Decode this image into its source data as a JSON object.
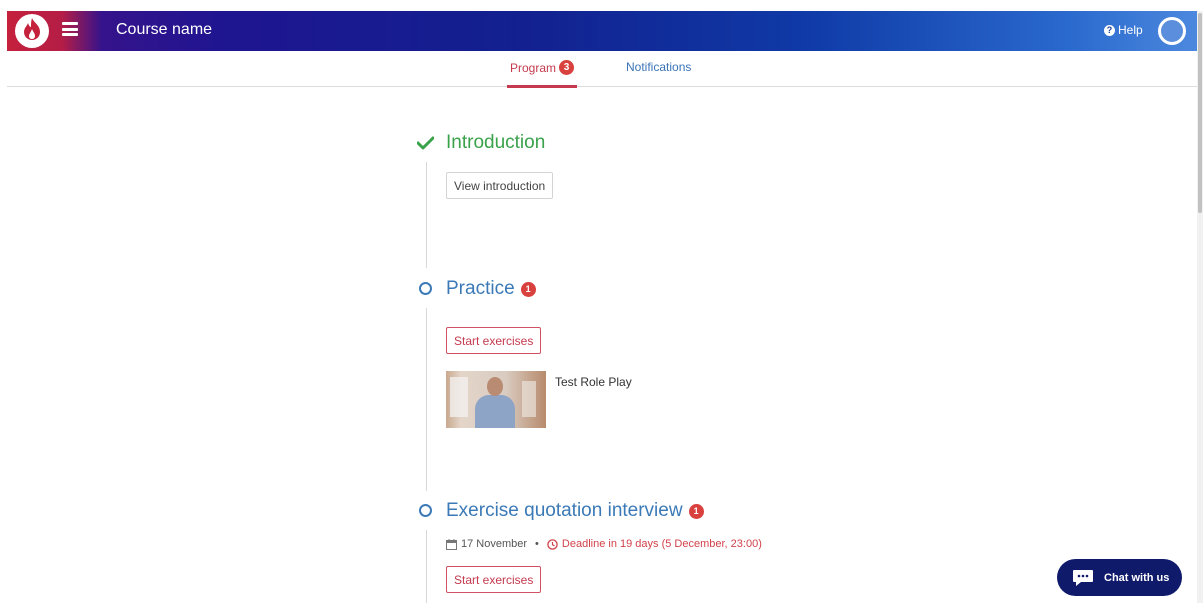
{
  "header": {
    "course_name": "Course name",
    "help_label": "Help"
  },
  "tabs": [
    {
      "label": "Program",
      "badge": "3",
      "active": true
    },
    {
      "label": "Notifications",
      "active": false
    }
  ],
  "sections": [
    {
      "title": "Introduction",
      "status": "completed",
      "button": "View introduction"
    },
    {
      "title": "Practice",
      "status": "open",
      "badge": "1",
      "button": "Start exercises",
      "item_label": "Test Role Play"
    },
    {
      "title": "Exercise quotation interview",
      "status": "open",
      "badge": "1",
      "date": "17 November",
      "deadline": "Deadline in 19 days (5 December, 23:00)",
      "button": "Start exercises"
    }
  ],
  "chat": {
    "label": "Chat with us"
  },
  "colors": {
    "accent_red": "#c53a4e",
    "link_blue": "#3b7ab7",
    "success_green": "#3aa24b",
    "badge_red": "#d9413f",
    "chat_navy": "#101a6b"
  }
}
